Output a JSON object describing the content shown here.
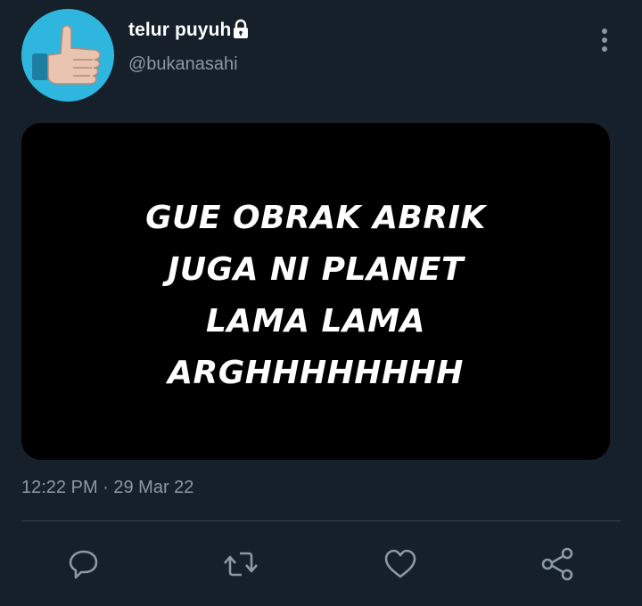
{
  "tweet": {
    "display_name": "telur puyuh",
    "handle": "@bukanasahi",
    "protected_icon": "lock-icon",
    "more_icon": "more-vertical-icon",
    "timestamp": "12:22 PM · 29 Mar 22",
    "media": {
      "lines": [
        "GUE OBRAK ABRIK",
        "JUGA NI PLANET",
        "LAMA LAMA",
        "ARGHHHHHHHH"
      ]
    }
  },
  "actions": {
    "reply_icon": "reply-icon",
    "retweet_icon": "retweet-icon",
    "like_icon": "heart-icon",
    "share_icon": "share-icon"
  },
  "colors": {
    "background": "#15202b",
    "secondary_text": "#8b98a5",
    "avatar_bg": "#2fb6df",
    "divider": "#38444d"
  }
}
